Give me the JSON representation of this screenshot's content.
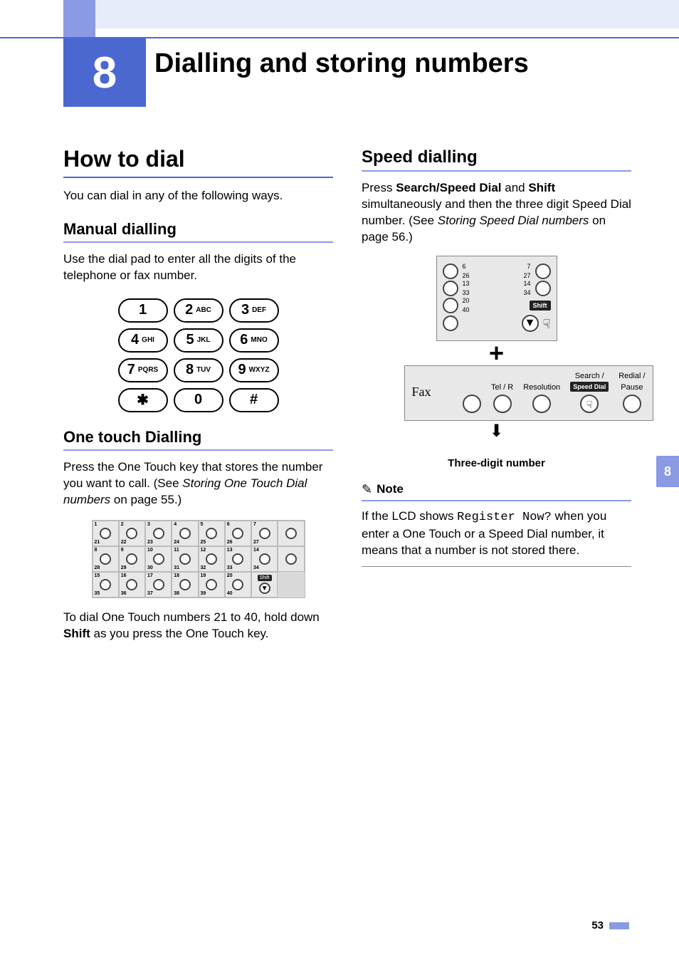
{
  "chapter": {
    "number": "8",
    "title": "Dialling and storing numbers"
  },
  "side_tab": "8",
  "page_number": "53",
  "left": {
    "how_to_dial": {
      "heading": "How to dial",
      "intro": "You can dial in any of the following ways."
    },
    "manual": {
      "heading": "Manual dialling",
      "body": "Use the dial pad to enter all the digits of the telephone or fax number.",
      "keys": [
        {
          "num": "1",
          "abc": ""
        },
        {
          "num": "2",
          "abc": "ABC"
        },
        {
          "num": "3",
          "abc": "DEF"
        },
        {
          "num": "4",
          "abc": "GHI"
        },
        {
          "num": "5",
          "abc": "JKL"
        },
        {
          "num": "6",
          "abc": "MNO"
        },
        {
          "num": "7",
          "abc": "PQRS"
        },
        {
          "num": "8",
          "abc": "TUV"
        },
        {
          "num": "9",
          "abc": "WXYZ"
        },
        {
          "num": "✱",
          "abc": ""
        },
        {
          "num": "0",
          "abc": ""
        },
        {
          "num": "#",
          "abc": ""
        }
      ]
    },
    "one_touch": {
      "heading": "One touch Dialling",
      "body_pre": "Press the One Touch key that stores the number you want to call. (See ",
      "body_ref": "Storing One Touch Dial numbers",
      "body_post": " on page 55.)",
      "shift_label": "Shift",
      "body2_pre": "To dial One Touch numbers 21 to 40, hold down ",
      "body2_bold": "Shift",
      "body2_post": " as you press the One Touch key.",
      "rows": [
        [
          [
            1,
            21
          ],
          [
            2,
            22
          ],
          [
            3,
            23
          ],
          [
            4,
            24
          ],
          [
            5,
            25
          ],
          [
            6,
            26
          ],
          [
            7,
            27
          ]
        ],
        [
          [
            8,
            28
          ],
          [
            9,
            29
          ],
          [
            10,
            30
          ],
          [
            11,
            31
          ],
          [
            12,
            32
          ],
          [
            13,
            33
          ],
          [
            14,
            34
          ]
        ],
        [
          [
            15,
            35
          ],
          [
            16,
            36
          ],
          [
            17,
            37
          ],
          [
            18,
            38
          ],
          [
            19,
            39
          ],
          [
            20,
            40
          ]
        ]
      ]
    }
  },
  "right": {
    "speed": {
      "heading": "Speed dialling",
      "body_pre": "Press ",
      "body_b1": "Search/Speed Dial",
      "body_mid1": " and ",
      "body_b2": "Shift",
      "body_mid2": " simultaneously and then the three digit Speed Dial number. (See ",
      "body_ref": "Storing Speed Dial numbers",
      "body_post": " on page 56.)",
      "diagram": {
        "pairs": [
          [
            6,
            26
          ],
          [
            7,
            27
          ],
          [
            13,
            33
          ],
          [
            14,
            34
          ],
          [
            20,
            40
          ]
        ],
        "shift_label": "Shift",
        "plus": "+",
        "fax_label": "Fax",
        "buttons": [
          "Tel / R",
          "Resolution"
        ],
        "search_top": "Search /",
        "search_bottom": "Speed Dial",
        "redial_top": "Redial /",
        "redial_bottom": "Pause",
        "caption": "Three-digit number"
      }
    },
    "note": {
      "title": "Note",
      "pre": "If the LCD shows ",
      "lcd": "Register Now?",
      "post": " when you enter a One Touch or a Speed Dial number, it means that a number is not stored there."
    }
  }
}
